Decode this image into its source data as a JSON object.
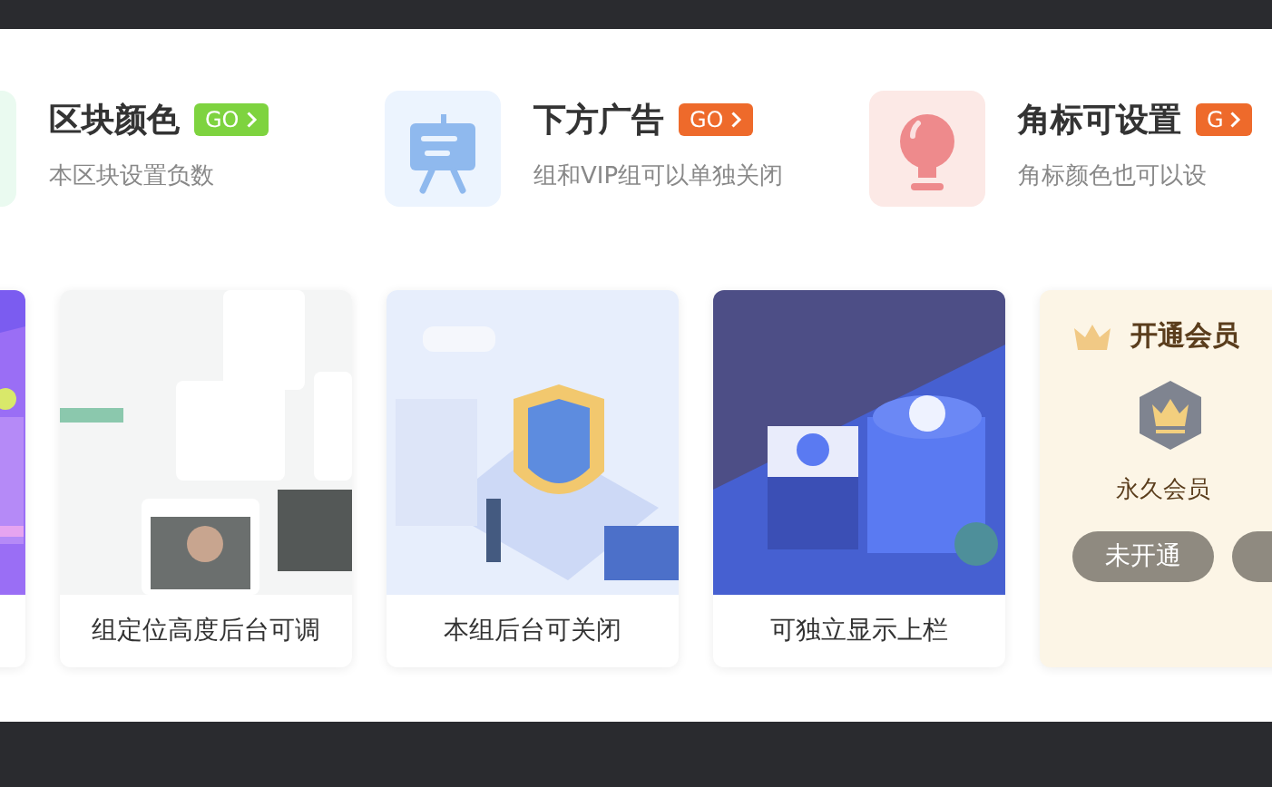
{
  "features": [
    {
      "title": "区块颜色",
      "badge": "GO",
      "color": "#7ed33f",
      "subtitle": "本区块设置负数"
    },
    {
      "title": "下方广告",
      "badge": "GO",
      "color": "#ee6a2b",
      "subtitle": "组和VIP组可以单独关闭"
    },
    {
      "title": "角标可设置",
      "badge": "G",
      "color": "#ee6a2b",
      "subtitle": "角标颜色也可以设"
    }
  ],
  "cards": [
    {
      "kind": "picture"
    },
    {
      "kind": "picture",
      "caption": "组定位高度后台可调"
    },
    {
      "kind": "picture",
      "caption": "本组后台可关闭"
    },
    {
      "kind": "picture",
      "caption": "可独立显示上栏"
    },
    {
      "kind": "member",
      "title": "开通会员",
      "level": "永久会员",
      "action": "未开通"
    }
  ]
}
